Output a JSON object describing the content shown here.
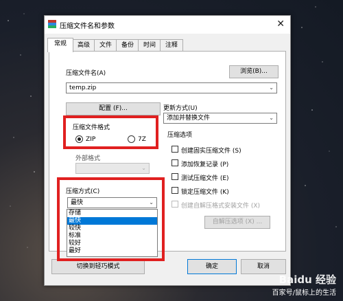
{
  "dialog": {
    "title": "压缩文件名和参数",
    "close_glyph": "✕"
  },
  "tabs": [
    "常规",
    "高级",
    "文件",
    "备份",
    "时间",
    "注释"
  ],
  "archive_name": {
    "label": "压缩文件名(A)",
    "value": "temp.zip",
    "browse_label": "浏览(B)..."
  },
  "profiles_label": "配置 (F)...",
  "update_mode": {
    "label": "更新方式(U)",
    "value": "添加并替换文件"
  },
  "archive_format": {
    "title": "压缩文件格式",
    "options": [
      "ZIP",
      "7Z"
    ],
    "selected": "ZIP",
    "external_label": "外部格式"
  },
  "compression_method": {
    "label": "压缩方式(C)",
    "value": "最快",
    "options": [
      "存储",
      "最快",
      "较快",
      "标准",
      "较好",
      "最好"
    ],
    "highlighted": "最快"
  },
  "compression_options": {
    "title": "压缩选项",
    "items": [
      {
        "label": "创建固实压缩文件 (S)",
        "checked": false,
        "disabled": false
      },
      {
        "label": "添加恢复记录 (P)",
        "checked": false,
        "disabled": false
      },
      {
        "label": "测试压缩文件 (E)",
        "checked": false,
        "disabled": false
      },
      {
        "label": "锁定压缩文件 (K)",
        "checked": false,
        "disabled": false
      },
      {
        "label": "创建自解压格式安装文件 (X)",
        "checked": false,
        "disabled": true
      }
    ],
    "sfx_button": "自解压选项 (X) ..."
  },
  "footer": {
    "wizard_button": "切换到轻巧模式",
    "ok_button": "确定",
    "cancel_button": "取消"
  },
  "watermark": {
    "logo": "Baidu 经验",
    "caption": "百家号/鼠标上的生活"
  },
  "colors": {
    "highlight_box": "#e02020",
    "selection": "#0078d7"
  }
}
